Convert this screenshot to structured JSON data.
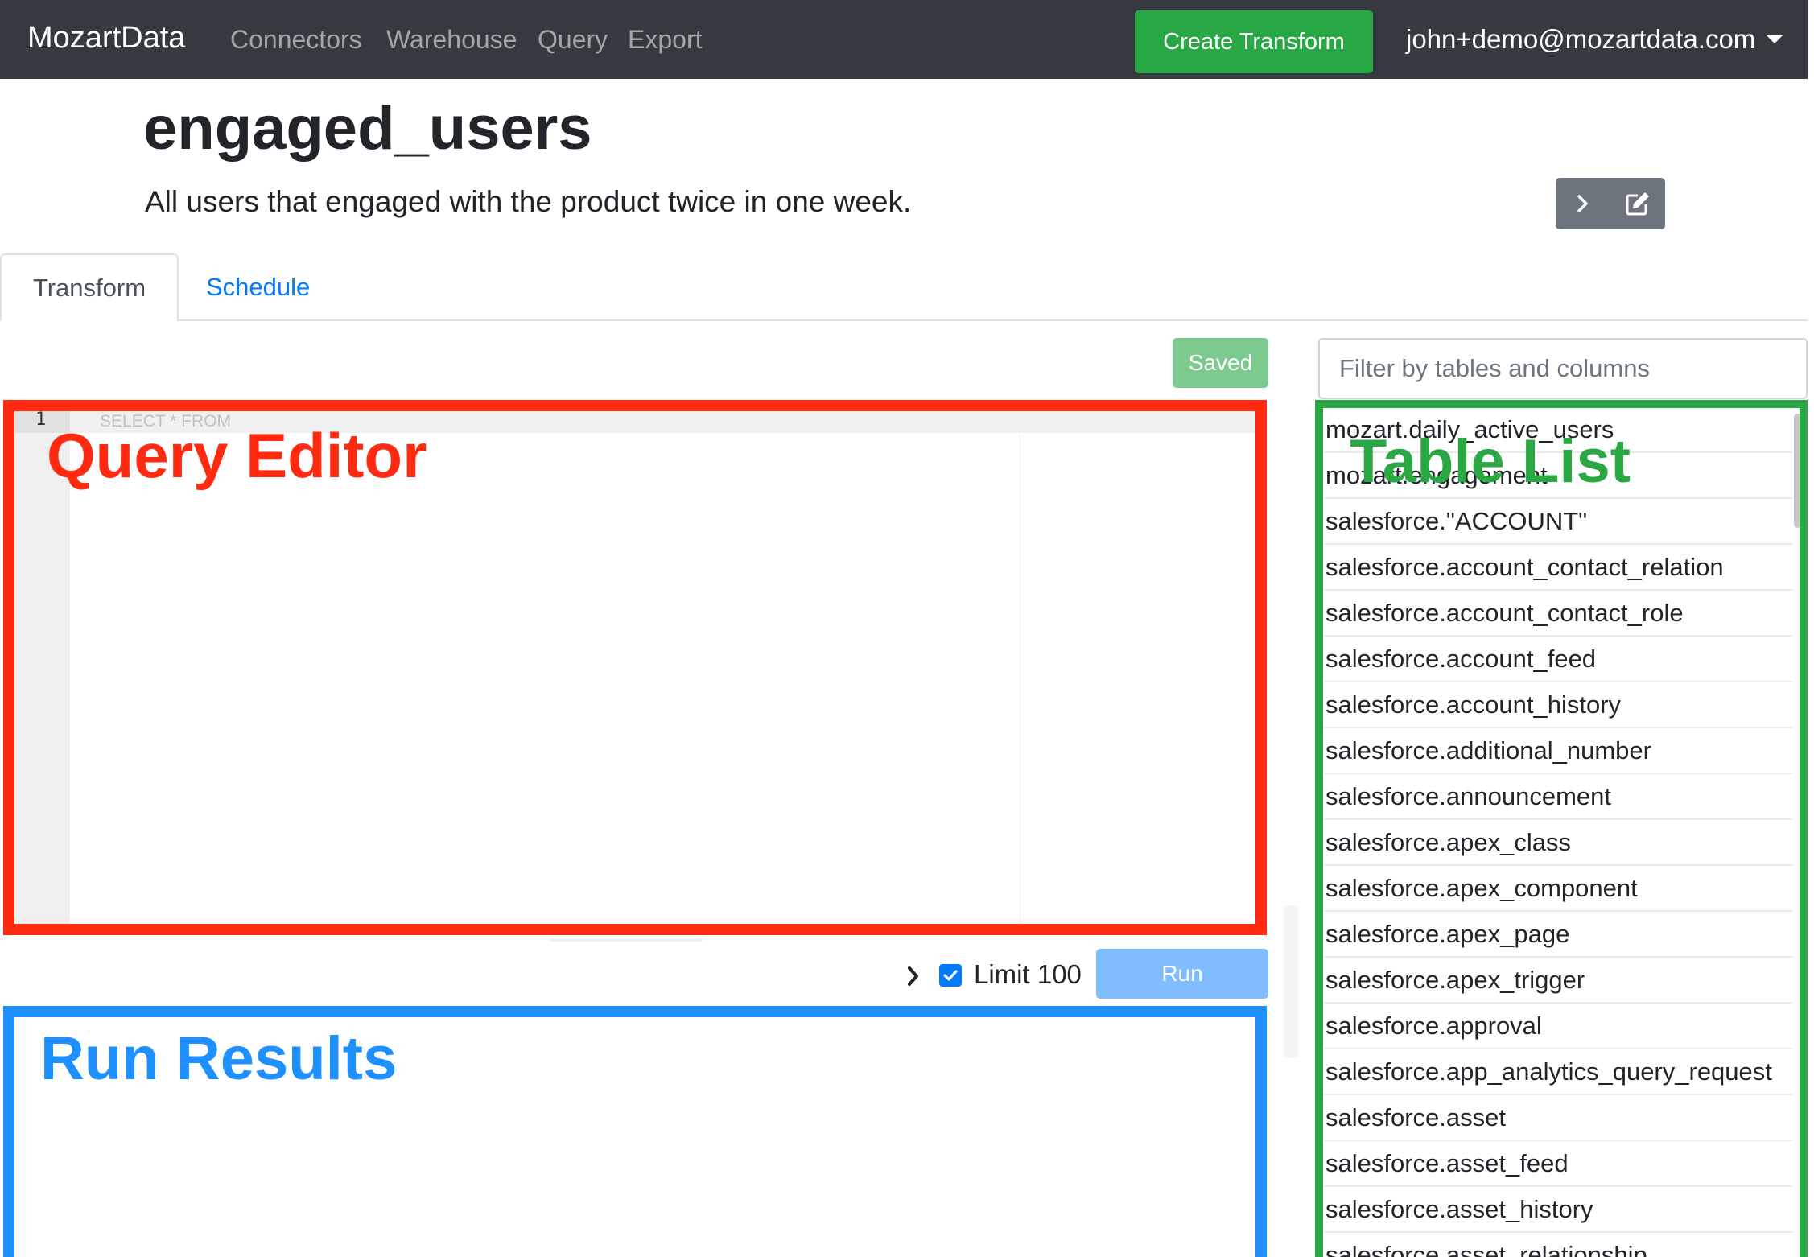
{
  "navbar": {
    "brand": "MozartData",
    "links": [
      "Connectors",
      "Warehouse",
      "Query",
      "Export"
    ],
    "create_button": "Create Transform",
    "user_email": "john+demo@mozartdata.com"
  },
  "header": {
    "title": "engaged_users",
    "description": "All users that engaged with the product twice in one week."
  },
  "tabs": [
    {
      "label": "Transform",
      "active": true
    },
    {
      "label": "Schedule",
      "active": false
    }
  ],
  "editor": {
    "status_label": "Saved",
    "line_number": "1",
    "placeholder": "SELECT * FROM"
  },
  "run_controls": {
    "limit_label": "Limit 100",
    "limit_checked": true,
    "run_button": "Run"
  },
  "table_panel": {
    "filter_placeholder": "Filter by tables and columns",
    "tables": [
      "mozart.daily_active_users",
      "mozart.engagement",
      "salesforce.\"ACCOUNT\"",
      "salesforce.account_contact_relation",
      "salesforce.account_contact_role",
      "salesforce.account_feed",
      "salesforce.account_history",
      "salesforce.additional_number",
      "salesforce.announcement",
      "salesforce.apex_class",
      "salesforce.apex_component",
      "salesforce.apex_page",
      "salesforce.apex_trigger",
      "salesforce.approval",
      "salesforce.app_analytics_query_request",
      "salesforce.asset",
      "salesforce.asset_feed",
      "salesforce.asset_history",
      "salesforce.asset_relationship"
    ]
  },
  "annotations": {
    "query_editor": "Query Editor",
    "table_list": "Table List",
    "run_results": "Run Results",
    "colors": {
      "red": "#ff2a0f",
      "green": "#2aa844",
      "blue": "#1e90ff"
    }
  },
  "colors": {
    "navbar_bg": "#343a40",
    "success": "#28a745",
    "primary": "#007bff",
    "secondary": "#6c757d"
  }
}
